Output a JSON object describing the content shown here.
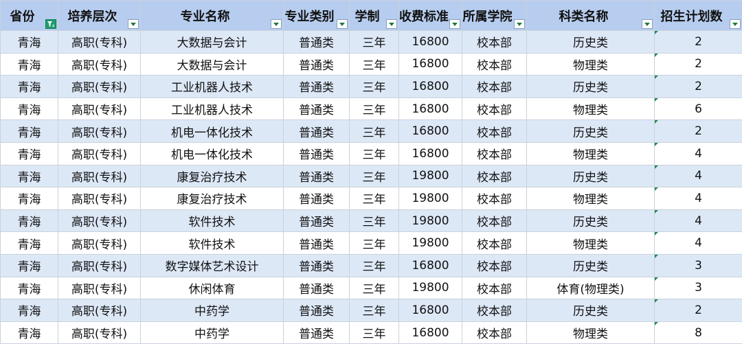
{
  "columns": [
    {
      "label": "省份",
      "filter_active": true
    },
    {
      "label": "培养层次",
      "filter_active": false
    },
    {
      "label": "专业名称",
      "filter_active": false
    },
    {
      "label": "专业类别",
      "filter_active": false
    },
    {
      "label": "学制",
      "filter_active": false
    },
    {
      "label": "收费标准",
      "filter_active": false
    },
    {
      "label": "所属学院",
      "filter_active": false
    },
    {
      "label": "科类名称",
      "filter_active": false
    },
    {
      "label": "招生计划数",
      "filter_active": false
    }
  ],
  "rows": [
    [
      "青海",
      "高职(专科)",
      "大数据与会计",
      "普通类",
      "三年",
      "16800",
      "校本部",
      "历史类",
      "2"
    ],
    [
      "青海",
      "高职(专科)",
      "大数据与会计",
      "普通类",
      "三年",
      "16800",
      "校本部",
      "物理类",
      "2"
    ],
    [
      "青海",
      "高职(专科)",
      "工业机器人技术",
      "普通类",
      "三年",
      "16800",
      "校本部",
      "历史类",
      "2"
    ],
    [
      "青海",
      "高职(专科)",
      "工业机器人技术",
      "普通类",
      "三年",
      "16800",
      "校本部",
      "物理类",
      "6"
    ],
    [
      "青海",
      "高职(专科)",
      "机电一体化技术",
      "普通类",
      "三年",
      "16800",
      "校本部",
      "历史类",
      "2"
    ],
    [
      "青海",
      "高职(专科)",
      "机电一体化技术",
      "普通类",
      "三年",
      "16800",
      "校本部",
      "物理类",
      "4"
    ],
    [
      "青海",
      "高职(专科)",
      "康复治疗技术",
      "普通类",
      "三年",
      "19800",
      "校本部",
      "历史类",
      "4"
    ],
    [
      "青海",
      "高职(专科)",
      "康复治疗技术",
      "普通类",
      "三年",
      "19800",
      "校本部",
      "物理类",
      "4"
    ],
    [
      "青海",
      "高职(专科)",
      "软件技术",
      "普通类",
      "三年",
      "19800",
      "校本部",
      "历史类",
      "4"
    ],
    [
      "青海",
      "高职(专科)",
      "软件技术",
      "普通类",
      "三年",
      "19800",
      "校本部",
      "物理类",
      "4"
    ],
    [
      "青海",
      "高职(专科)",
      "数字媒体艺术设计",
      "普通类",
      "三年",
      "16800",
      "校本部",
      "历史类",
      "3"
    ],
    [
      "青海",
      "高职(专科)",
      "休闲体育",
      "普通类",
      "三年",
      "19800",
      "校本部",
      "体育(物理类)",
      "3"
    ],
    [
      "青海",
      "高职(专科)",
      "中药学",
      "普通类",
      "三年",
      "16800",
      "校本部",
      "历史类",
      "2"
    ],
    [
      "青海",
      "高职(专科)",
      "中药学",
      "普通类",
      "三年",
      "16800",
      "校本部",
      "物理类",
      "8"
    ]
  ],
  "colors": {
    "header_bg": "#b7cdef",
    "band_bg": "#dde8f7",
    "filter_active": "#1f9e6e"
  },
  "icons": {
    "filter_dropdown": "dropdown-arrow-icon",
    "filter_applied": "filter-applied-icon"
  }
}
